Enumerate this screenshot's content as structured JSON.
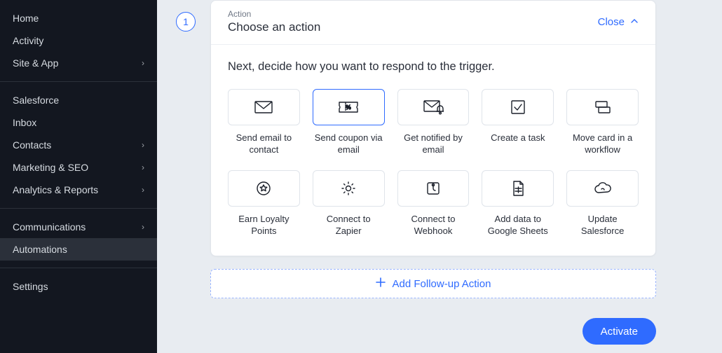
{
  "sidebar": {
    "groups": [
      [
        {
          "label": "Home",
          "chev": false
        },
        {
          "label": "Activity",
          "chev": false
        },
        {
          "label": "Site & App",
          "chev": true
        }
      ],
      [
        {
          "label": "Salesforce",
          "chev": false
        },
        {
          "label": "Inbox",
          "chev": false
        },
        {
          "label": "Contacts",
          "chev": true
        },
        {
          "label": "Marketing & SEO",
          "chev": true
        },
        {
          "label": "Analytics & Reports",
          "chev": true
        }
      ],
      [
        {
          "label": "Communications",
          "chev": true
        },
        {
          "label": "Automations",
          "chev": false,
          "active": true
        }
      ],
      [
        {
          "label": "Settings",
          "chev": false
        }
      ]
    ]
  },
  "panel": {
    "step": "1",
    "subhead": "Action",
    "title": "Choose an action",
    "close": "Close",
    "prompt": "Next, decide how you want to respond to the trigger."
  },
  "actions": [
    {
      "name": "send-email-contact",
      "label": "Send email to contact",
      "icon": "envelope"
    },
    {
      "name": "send-coupon",
      "label": "Send coupon via email",
      "icon": "coupon",
      "highlight": true
    },
    {
      "name": "get-notified",
      "label": "Get notified by email",
      "icon": "envelope-bell"
    },
    {
      "name": "create-task",
      "label": "Create a task",
      "icon": "check-square"
    },
    {
      "name": "move-card",
      "label": "Move card in a workflow",
      "icon": "cards"
    },
    {
      "name": "earn-loyalty",
      "label": "Earn Loyalty Points",
      "icon": "star-circle"
    },
    {
      "name": "connect-zapier",
      "label": "Connect to Zapier",
      "icon": "gear"
    },
    {
      "name": "connect-webhook",
      "label": "Connect to Webhook",
      "icon": "webhook"
    },
    {
      "name": "google-sheets",
      "label": "Add data to Google Sheets",
      "icon": "sheet"
    },
    {
      "name": "update-salesforce",
      "label": "Update Salesforce",
      "icon": "cloud"
    }
  ],
  "follow": {
    "label": "Add Follow-up Action"
  },
  "activate": {
    "label": "Activate"
  }
}
